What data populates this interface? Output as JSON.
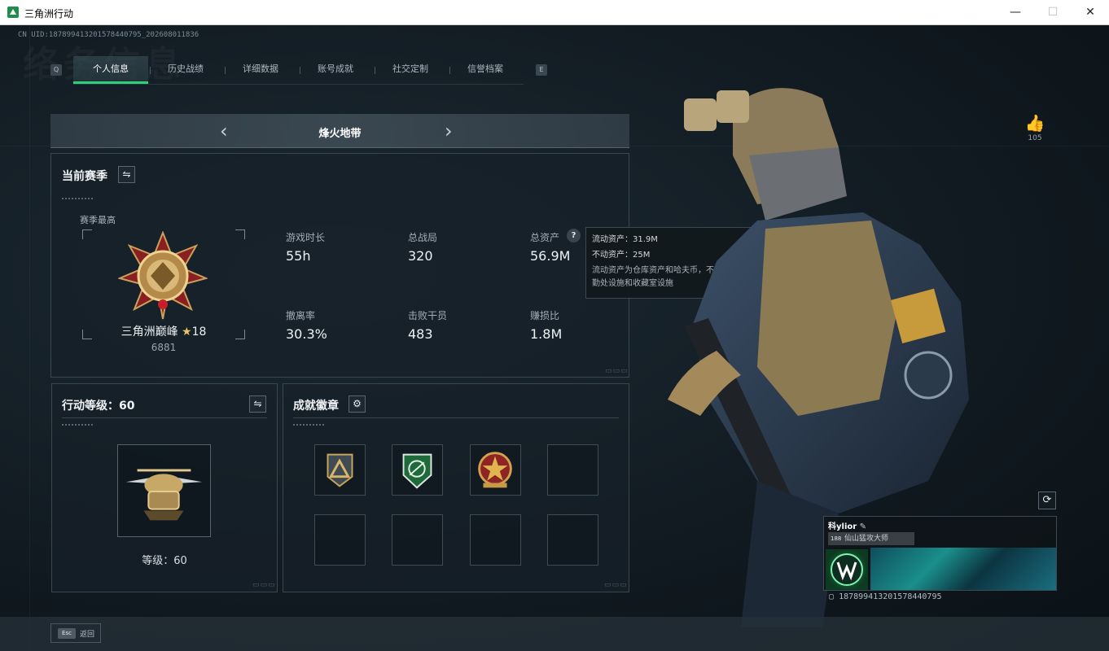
{
  "window": {
    "title": "三角洲行动",
    "minimize_glyph": "—",
    "maximize_glyph": "☐",
    "close_glyph": "✕"
  },
  "uid_top": "CN UID:1878994132015784407​95_202608011836",
  "tabs": {
    "left_key": "Q",
    "right_key": "E",
    "items": [
      "个人信息",
      "历史战绩",
      "详细数据",
      "账号成就",
      "社交定制",
      "信誉档案"
    ],
    "active_index": 0
  },
  "mode": {
    "label": "烽火地带",
    "prev_glyph": "‹",
    "next_glyph": "›"
  },
  "season": {
    "title": "当前赛季",
    "swap_icon": "swap-icon",
    "best_label": "赛季最高",
    "rank_name": "三角洲巅峰",
    "rank_stars": "18",
    "rank_score": "6881",
    "stats": [
      {
        "label": "游戏时长",
        "value": "55h"
      },
      {
        "label": "总战局",
        "value": "320"
      },
      {
        "label": "总资产",
        "value": "56.9M",
        "help": "?"
      },
      {
        "label": "撤离率",
        "value": "30.3%"
      },
      {
        "label": "击败干员",
        "value": "483"
      },
      {
        "label": "赚损比",
        "value": "1.8M"
      }
    ],
    "corner": "▭▭▭"
  },
  "tooltip": {
    "liquid": "流动资产：31.9M",
    "fixed": "不动资产：25M",
    "desc": "流动资产为仓库资产和哈夫币，不动资产为特勤处设施和收藏室设施"
  },
  "level": {
    "title": "行动等级：60",
    "text": "等级：60",
    "corner": "▭▭▭"
  },
  "badges": {
    "title": "成就徽章",
    "settings_icon": "gear-icon",
    "corner": "▭▭▭"
  },
  "likes": {
    "count": "105"
  },
  "profile": {
    "name": "科ylior",
    "tag_level": "188",
    "tag": "仙山猛攻大师",
    "uid": "1878994132015784407​95"
  },
  "footer": {
    "esc_key": "Esc",
    "back": "返回"
  },
  "colors": {
    "accent": "#2fd07a",
    "bg": "#121b22",
    "panel": "#162028"
  }
}
